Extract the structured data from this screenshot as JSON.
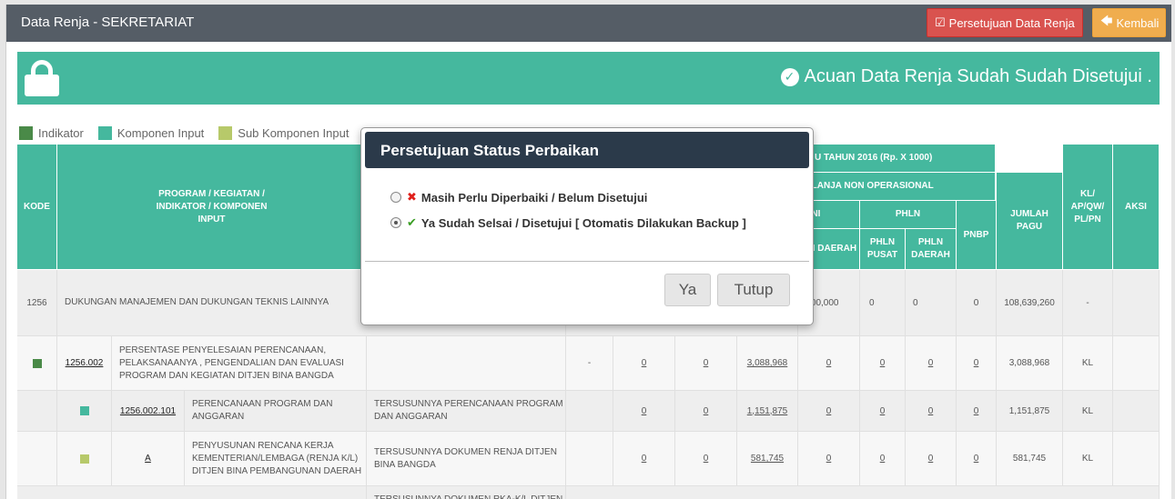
{
  "header": {
    "title": "Data Renja - SEKRETARIAT",
    "approve_button": "Persetujuan Data Renja",
    "back_button": "Kembali"
  },
  "banner": {
    "message": "Acuan Data Renja Sudah Sudah Disetujui ."
  },
  "legend": [
    {
      "label": "Indikator",
      "color": "#4a8a48"
    },
    {
      "label": "Komponen Input",
      "color": "#45b89e"
    },
    {
      "label": "Sub Komponen Input",
      "color": "#b7c96a"
    }
  ],
  "table": {
    "headers": {
      "kode": "KODE",
      "program": "PROGRAM / KEGIATAN / INDIKATOR / KOMPONEN INPUT",
      "pagu": "U TAHUN 2016 (Rp. X 1000)",
      "nonops": "ELANJA NON OPERASIONAL",
      "rm_group": "URNI",
      "rm_daerah": "RM DAERAH",
      "phln": "PHLN",
      "phln_pusat": "PHLN PUSAT",
      "phln_daerah": "PHLN DAERAH",
      "pnbp": "PNBP",
      "jumlah": "JUMLAH PAGU",
      "kl": "KL/ AP/QW/ PL/PN",
      "aksi": "AKSI"
    },
    "row1": {
      "code": "1256",
      "name": "DUKUNGAN MANAJEMEN DAN DUKUNGAN TEKNIS LAINNYA",
      "rm_daerah": "8,000,000",
      "phln_pusat": "0",
      "phln_daerah": "0",
      "pnbp": "0",
      "jumlah": "108,639,260",
      "kl": "-"
    },
    "row2": {
      "code": "1256.002",
      "name": "PERSENTASE PENYELESAIAN PERENCANAAN, PELAKSANAANYA , PENGENDALIAN DAN EVALUASI PROGRAM DAN KEGIATAN DITJEN BINA BANGDA",
      "sasaran": "-",
      "a": "0",
      "b": "0",
      "c": "3,088,968",
      "d": "0",
      "e": "0",
      "f": "0",
      "g": "0",
      "jumlah": "3,088,968",
      "kl": "KL"
    },
    "row3": {
      "code": "1256.002.101",
      "name": "PERENCANAAN PROGRAM DAN ANGGARAN",
      "output": "TERSUSUNNYA PERENCANAAN PROGRAM DAN ANGGARAN",
      "a": "0",
      "b": "0",
      "c": "1,151,875",
      "d": "0",
      "e": "0",
      "f": "0",
      "g": "0",
      "jumlah": "1,151,875",
      "kl": "KL"
    },
    "row4": {
      "code": "A",
      "name": "PENYUSUNAN RENCANA KERJA KEMENTERIAN/LEMBAGA (RENJA K/L) DITJEN BINA PEMBANGUNAN DAERAH",
      "output": "TERSUSUNNYA DOKUMEN RENJA DITJEN BINA BANGDA",
      "a": "0",
      "b": "0",
      "c": "581,745",
      "d": "0",
      "e": "0",
      "f": "0",
      "g": "0",
      "jumlah": "581,745",
      "kl": "KL"
    },
    "row5": {
      "output": "TERSUSUNNYA DOKUMEN RKA-K/L DITJEN"
    }
  },
  "modal": {
    "title": "Persetujuan Status Perbaikan",
    "option1": "Masih Perlu Diperbaiki / Belum Disetujui",
    "option2": "Ya Sudah Selsai / Disetujui [ Otomatis Dilakukan Backup ]",
    "selected": "option2",
    "yes_button": "Ya",
    "close_button": "Tutup"
  }
}
